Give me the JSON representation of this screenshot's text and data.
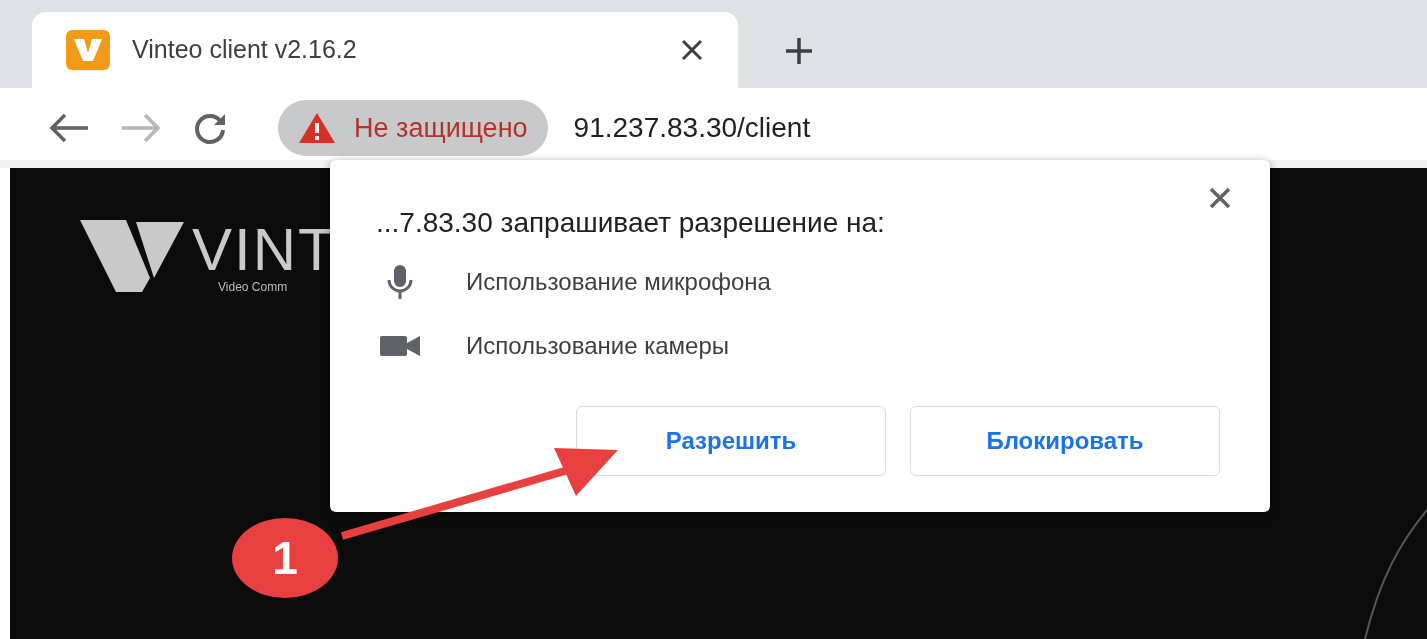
{
  "tab": {
    "title": "Vinteo client v2.16.2"
  },
  "toolbar": {
    "back": {
      "disabled": false
    },
    "forward": {
      "disabled": true
    },
    "security_label": "Не защищено",
    "url": "91.237.83.30/client"
  },
  "page": {
    "logo_text": "VINT",
    "tagline": "Video Comm"
  },
  "permission_dialog": {
    "title": "...7.83.30 запрашивает разрешение на:",
    "permissions": [
      {
        "kind": "microphone",
        "label": "Использование микрофона"
      },
      {
        "kind": "camera",
        "label": "Использование камеры"
      }
    ],
    "buttons": [
      {
        "label": "Разрешить"
      },
      {
        "label": "Блокировать"
      }
    ]
  },
  "annotation": {
    "number": "1"
  }
}
